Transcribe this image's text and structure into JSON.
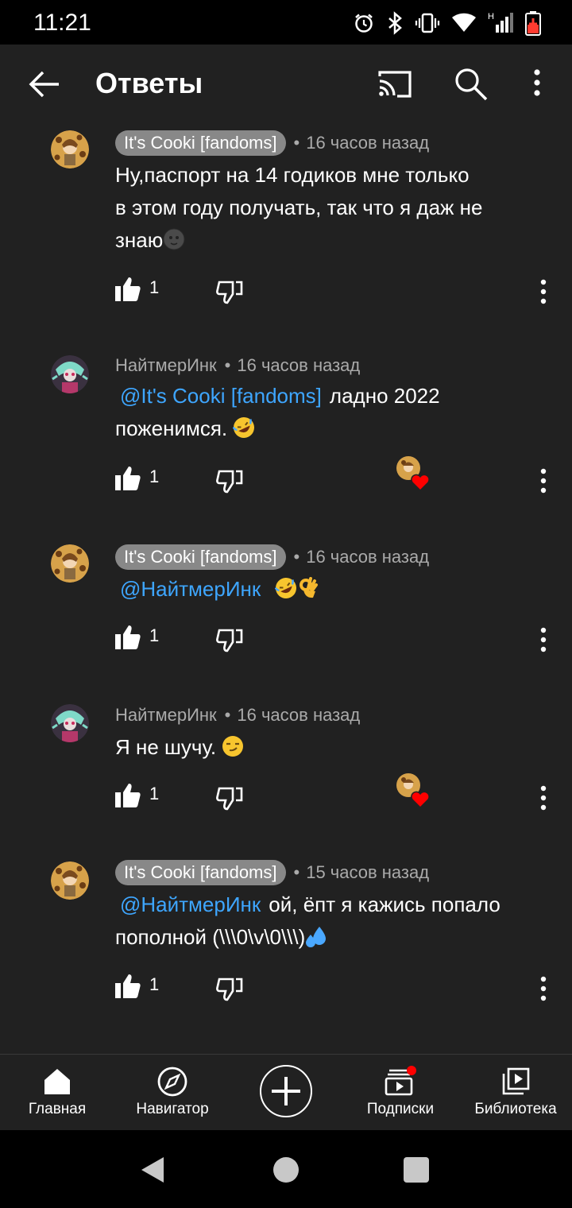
{
  "status_bar": {
    "time": "11:21",
    "icons": [
      "alarm-icon",
      "bluetooth-icon",
      "vibrate-icon",
      "wifi-icon",
      "signal-icon",
      "battery-icon"
    ],
    "network_label": "H"
  },
  "app_bar": {
    "title": "Ответы",
    "icons": [
      "back-arrow-icon",
      "cast-icon",
      "search-icon",
      "more-vert-icon"
    ]
  },
  "colors": {
    "background": "#212121",
    "mention": "#3ea6ff",
    "author_chip": "#888888",
    "meta_text": "#aaaaaa",
    "heart": "#ff0000"
  },
  "comments": [
    {
      "author": "It's Cooki [fandoms]",
      "author_is_owner": true,
      "time": "16 часов назад",
      "mention": "",
      "text_lines": [
        "Ну,паспорт на 14 годиков мне только",
        "в этом году получать, так что я даж не",
        "знаю"
      ],
      "emoji": [
        "new-moon-face"
      ],
      "likes": "1",
      "hearted": false
    },
    {
      "author": "НайтмерИнк",
      "author_is_owner": false,
      "time": "16 часов назад",
      "mention": "@It's Cooki [fandoms]",
      "text_after_mention": "ладно 2022",
      "text_line2": "поженимся.",
      "emoji": [
        "rolling-laughing"
      ],
      "likes": "1",
      "hearted": true
    },
    {
      "author": "It's Cooki [fandoms]",
      "author_is_owner": true,
      "time": "16 часов назад",
      "mention": "@НайтмерИнк",
      "emoji": [
        "rolling-laughing",
        "ok-hand"
      ],
      "likes": "1",
      "hearted": false
    },
    {
      "author": "НайтмерИнк",
      "author_is_owner": false,
      "time": "16 часов назад",
      "text": "Я не шучу.",
      "emoji": [
        "smirk"
      ],
      "likes": "1",
      "hearted": true
    },
    {
      "author": "It's Cooki [fandoms]",
      "author_is_owner": true,
      "time": "15 часов назад",
      "mention": "@НайтмерИнк",
      "text_after_mention": "ой, ёпт я кажись попало",
      "text_line2": "пополной (\\\\\\0\\v\\0\\\\\\)",
      "emoji": [
        "sweat-droplets"
      ],
      "likes": "1",
      "hearted": false
    }
  ],
  "bottom_nav": {
    "items": [
      {
        "label": "Главная",
        "icon": "home-icon"
      },
      {
        "label": "Навигатор",
        "icon": "compass-icon"
      },
      {
        "label": "",
        "icon": "create-plus-icon"
      },
      {
        "label": "Подписки",
        "icon": "subscriptions-icon"
      },
      {
        "label": "Библиотека",
        "icon": "library-icon"
      }
    ]
  },
  "system_nav": {
    "icons": [
      "system-back-icon",
      "system-home-icon",
      "system-recents-icon"
    ]
  }
}
